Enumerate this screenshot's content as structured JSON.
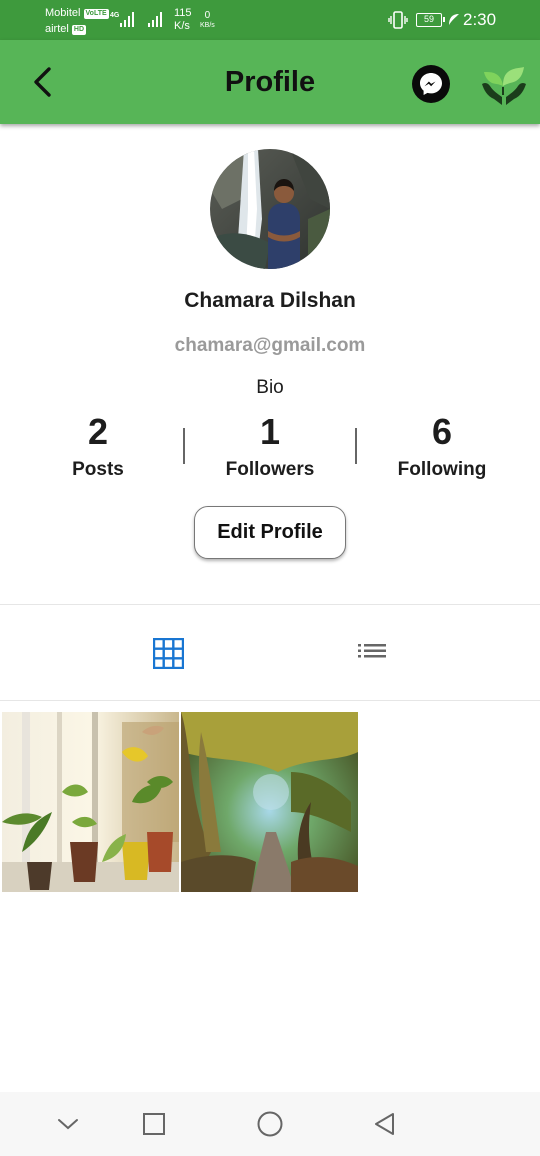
{
  "status_bar": {
    "carrier1": "Mobitel",
    "carrier1_tag": "VoLTE",
    "carrier2": "airtel",
    "carrier2_tag": "HD",
    "network": "4G",
    "speed_value": "115",
    "speed_unit": "K/s",
    "speed2_value": "0",
    "speed2_unit": "KB/s",
    "battery": "59",
    "time": "2:30"
  },
  "app_bar": {
    "title": "Profile",
    "back_icon": "chevron-left-icon",
    "messenger_icon": "messenger-icon",
    "eco_icon": "hands-plant-icon",
    "color": "#57b557"
  },
  "profile": {
    "name": "Chamara Dilshan",
    "email": "chamara@gmail.com",
    "bio": "Bio"
  },
  "stats": [
    {
      "value": "2",
      "label": "Posts"
    },
    {
      "value": "1",
      "label": "Followers"
    },
    {
      "value": "6",
      "label": "Following"
    }
  ],
  "edit_profile_label": "Edit Profile",
  "tabs": [
    {
      "name": "grid",
      "icon": "grid-icon",
      "active": true
    },
    {
      "name": "list",
      "icon": "list-icon",
      "active": false
    }
  ],
  "posts": [
    {
      "image": "potted-plants-window-photo"
    },
    {
      "image": "forest-tree-path-photo"
    }
  ],
  "nav_bar": [
    "chevron-down-icon",
    "square-icon",
    "circle-icon",
    "triangle-back-icon"
  ],
  "colors": {
    "accent_blue": "#1976d2",
    "status_green": "#3e9a3d"
  }
}
